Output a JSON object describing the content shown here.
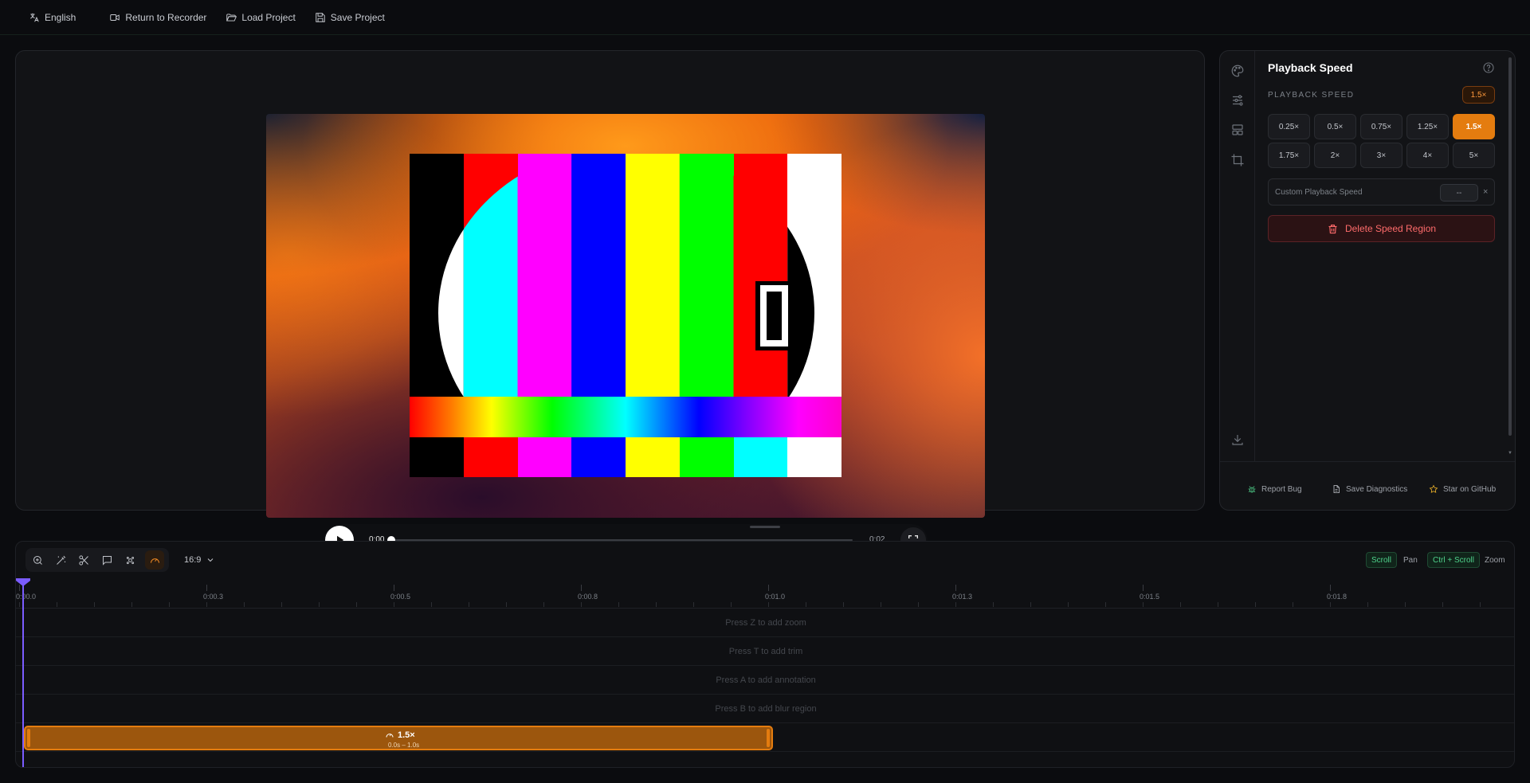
{
  "topbar": {
    "language": "English",
    "return_to_recorder": "Return to Recorder",
    "load_project": "Load Project",
    "save_project": "Save Project"
  },
  "player": {
    "current_time": "0:00",
    "duration": "0:02",
    "progress": 0
  },
  "panel": {
    "title": "Playback Speed",
    "section_label": "PLAYBACK SPEED",
    "current_speed": "1.5×",
    "speeds": [
      "0.25×",
      "0.5×",
      "0.75×",
      "1.25×",
      "1.5×",
      "1.75×",
      "2×",
      "3×",
      "4×",
      "5×"
    ],
    "active_speed_index": 4,
    "custom_label": "Custom Playback Speed",
    "custom_value": "--",
    "custom_clear": "×",
    "delete_label": "Delete Speed Region"
  },
  "footer": {
    "report_bug": "Report Bug",
    "save_diagnostics": "Save Diagnostics",
    "star_github": "Star on GitHub"
  },
  "timeline": {
    "aspect_ratio": "16:9",
    "hint_scroll_key": "Scroll",
    "hint_scroll_action": "Pan",
    "hint_zoom_key": "Ctrl + Scroll",
    "hint_zoom_action": "Zoom",
    "ticks": [
      "0:00.0",
      "0:00.3",
      "0:00.5",
      "0:00.8",
      "0:01.0",
      "0:01.3",
      "0:01.5",
      "0:01.8"
    ],
    "tracks": [
      "Press Z to add zoom",
      "Press T to add trim",
      "Press A to add annotation",
      "Press B to add blur region"
    ],
    "region": {
      "speed": "1.5×",
      "range": "0.0s – 1.0s"
    }
  },
  "colors": {
    "accent": "#e47c0f",
    "playhead": "#7b5cff",
    "danger": "#ff6b6b",
    "hint_green": "#4fd18b"
  }
}
